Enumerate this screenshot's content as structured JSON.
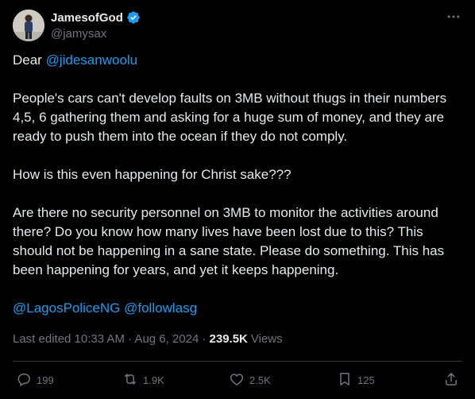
{
  "author": {
    "display_name": "JamesofGod",
    "handle": "@jamysax",
    "verified": true
  },
  "post": {
    "greeting": "Dear ",
    "greeting_mention": "@jidesanwoolu",
    "paragraph_1": "People's cars can't develop faults on 3MB without thugs in their numbers 4,5, 6 gathering them and asking for a huge sum of money, and they are ready to push them into the ocean if they do not comply.",
    "paragraph_2": "How is this even happening for Christ sake???",
    "paragraph_3": "Are there no security personnel on 3MB to monitor the activities around there? Do you know how many lives have been lost due to this? This should not be happening in a sane state. Please do something. This has been happening for years, and yet it keeps happening.",
    "mention_1": "@LagosPoliceNG",
    "mention_2": "@followlasg"
  },
  "meta": {
    "edited": "Last edited 10:33 AM · Aug 6, 2024 ·",
    "views_count": "239.5K",
    "views_label": "Views"
  },
  "actions": {
    "replies": "199",
    "reposts": "1.9K",
    "likes": "2.5K",
    "bookmarks": "125"
  },
  "icons": {
    "verified": "verified-badge-icon",
    "more": "more-icon",
    "reply": "reply-icon",
    "repost": "repost-icon",
    "like": "like-icon",
    "bookmark": "bookmark-icon",
    "share": "share-icon"
  },
  "colors": {
    "background": "#000000",
    "text": "#e7e9ea",
    "muted": "#71767b",
    "accent": "#1d9bf0",
    "divider": "#2f3336"
  }
}
